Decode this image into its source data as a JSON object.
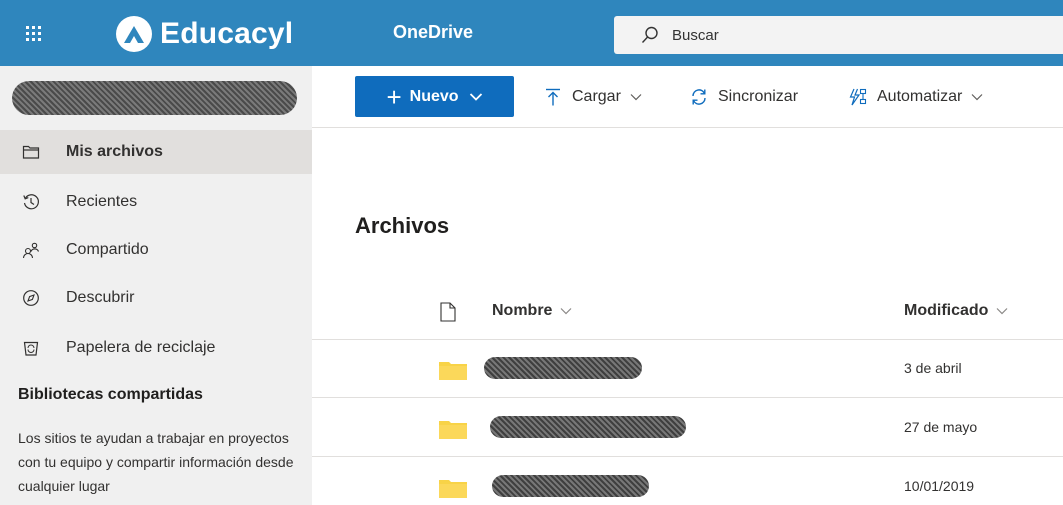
{
  "topbar": {
    "brand": "Educacyl",
    "app_name": "OneDrive",
    "search_placeholder": "Buscar",
    "colors": {
      "bar": "#2f86bd",
      "search_bg": "#f3f3f3"
    }
  },
  "sidebar": {
    "items": [
      {
        "label": "Mis archivos",
        "icon": "folder-icon",
        "active": true
      },
      {
        "label": "Recientes",
        "icon": "history-icon"
      },
      {
        "label": "Compartido",
        "icon": "people-icon"
      },
      {
        "label": "Descubrir",
        "icon": "compass-icon"
      },
      {
        "label": "Papelera de reciclaje",
        "icon": "recycle-bin-icon"
      }
    ],
    "libraries_heading": "Bibliotecas compartidas",
    "libraries_text": "Los sitios te ayudan a trabajar en proyectos con tu equipo y compartir información desde cualquier lugar"
  },
  "commandbar": {
    "new_label": "Nuevo",
    "upload_label": "Cargar",
    "sync_label": "Sincronizar",
    "automate_label": "Automatizar",
    "colors": {
      "primary": "#0f6cbd"
    }
  },
  "main": {
    "title": "Archivos",
    "columns": {
      "name": "Nombre",
      "modified": "Modificado"
    },
    "rows": [
      {
        "modified": "3 de abril"
      },
      {
        "modified": "27 de mayo"
      },
      {
        "modified": "10/01/2019"
      }
    ],
    "colors": {
      "folder": "#f8d347"
    }
  }
}
